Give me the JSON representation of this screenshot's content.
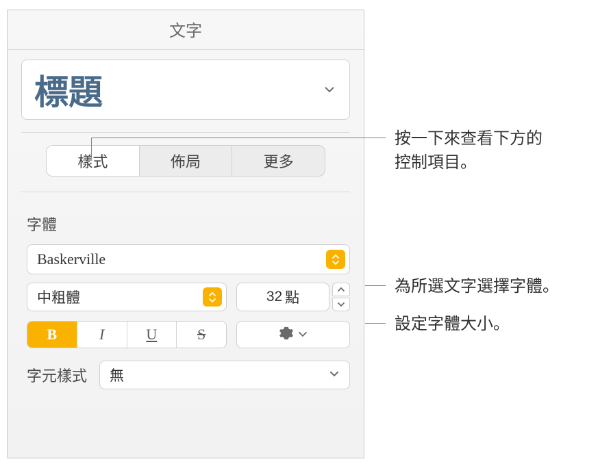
{
  "panel": {
    "title": "文字",
    "paragraph_style": "標題"
  },
  "tabs": {
    "style": "樣式",
    "layout": "佈局",
    "more": "更多"
  },
  "font": {
    "section_label": "字體",
    "family": "Baskerville",
    "weight": "中粗體",
    "size_value": "32",
    "size_unit": "點",
    "bold": "B",
    "italic": "I",
    "underline": "U",
    "strike": "S"
  },
  "char_style": {
    "label": "字元樣式",
    "value": "無"
  },
  "callouts": {
    "tab_note_line1": "按一下來查看下方的",
    "tab_note_line2": "控制項目。",
    "font_note": "為所選文字選擇字體。",
    "size_note": "設定字體大小。"
  }
}
